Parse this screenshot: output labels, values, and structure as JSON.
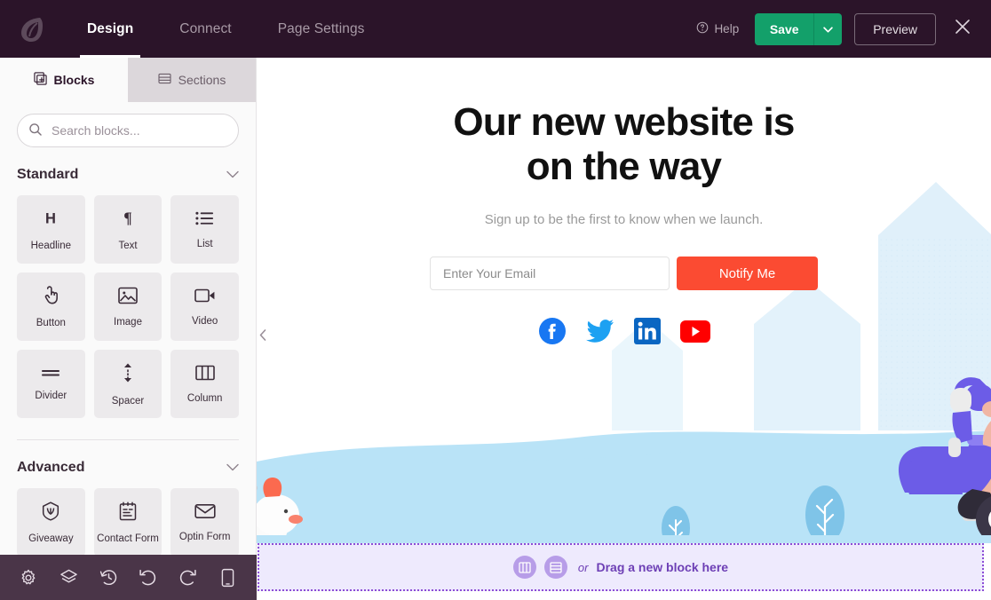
{
  "topbar": {
    "logo": "leaf-logo",
    "nav": [
      {
        "label": "Design",
        "active": true
      },
      {
        "label": "Connect",
        "active": false
      },
      {
        "label": "Page Settings",
        "active": false
      }
    ],
    "help_label": "Help",
    "save_label": "Save",
    "save_caret": "chevron-down",
    "preview_label": "Preview",
    "close_label": "×",
    "colors": {
      "bar_bg": "#2b1429",
      "save_green": "#13a06a",
      "active_text": "#ffffff",
      "inactive_text": "#a89aa6"
    }
  },
  "sidebar": {
    "tabs": [
      {
        "label": "Blocks",
        "icon": "blocks-icon",
        "active": true
      },
      {
        "label": "Sections",
        "icon": "sections-icon",
        "active": false
      }
    ],
    "search": {
      "value": "",
      "placeholder": "Search blocks..."
    },
    "groups": [
      {
        "title": "Standard",
        "collapsed": false,
        "blocks": [
          {
            "label": "Headline",
            "icon": "headline-icon"
          },
          {
            "label": "Text",
            "icon": "text-icon"
          },
          {
            "label": "List",
            "icon": "list-icon"
          },
          {
            "label": "Button",
            "icon": "button-icon"
          },
          {
            "label": "Image",
            "icon": "image-icon"
          },
          {
            "label": "Video",
            "icon": "video-icon"
          },
          {
            "label": "Divider",
            "icon": "divider-icon"
          },
          {
            "label": "Spacer",
            "icon": "spacer-icon"
          },
          {
            "label": "Column",
            "icon": "column-icon"
          }
        ]
      },
      {
        "title": "Advanced",
        "collapsed": false,
        "blocks": [
          {
            "label": "Giveaway",
            "icon": "giveaway-icon"
          },
          {
            "label": "Contact Form",
            "icon": "contact-form-icon"
          },
          {
            "label": "Optin Form",
            "icon": "optin-form-icon"
          }
        ]
      }
    ],
    "bottom_tools": [
      {
        "name": "settings-icon"
      },
      {
        "name": "layers-icon"
      },
      {
        "name": "history-icon"
      },
      {
        "name": "undo-icon"
      },
      {
        "name": "redo-icon"
      },
      {
        "name": "mobile-preview-icon"
      }
    ],
    "colors": {
      "panel_bg": "#fafafa",
      "cell_bg": "#eceaec",
      "bottombar_bg": "#4a3548"
    }
  },
  "canvas": {
    "collapse_handle": "chevron-left",
    "hero": {
      "title_line1": "Our new website is",
      "title_line2": "on the way",
      "subtitle": "Sign up to be the first to know when we launch.",
      "email_value": "",
      "email_placeholder": "Enter Your Email",
      "notify_label": "Notify Me",
      "socials": [
        {
          "name": "facebook-icon",
          "color": "#1877f2"
        },
        {
          "name": "twitter-icon",
          "color": "#1da1f2"
        },
        {
          "name": "linkedin-icon",
          "color": "#0a66c2"
        },
        {
          "name": "youtube-icon",
          "color": "#ff0000"
        }
      ],
      "colors": {
        "accent": "#fb4b32",
        "sky": "#b9e3f7",
        "scooter": "#6c5ce7",
        "hair": "#f04a3a"
      }
    }
  },
  "dropzone": {
    "column_icon": "columns-icon",
    "section_icon": "section-icon",
    "or_label": "or",
    "text": "Drag a new block here",
    "colors": {
      "bg": "#eeeafd",
      "border": "#8c4dd6",
      "text": "#6d3fb5"
    }
  }
}
